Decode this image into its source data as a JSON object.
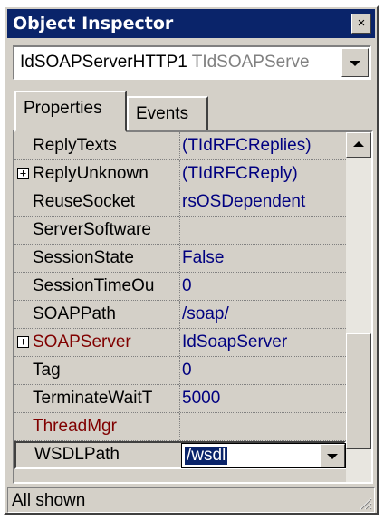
{
  "window": {
    "title": "Object Inspector",
    "close_glyph": "×"
  },
  "component": {
    "name": "IdSOAPServerHTTP1",
    "type": "TIdSOAPServe"
  },
  "tabs": [
    "Properties",
    "Events"
  ],
  "properties": [
    {
      "name": "ReplyTexts",
      "value": "(TIdRFCReplies)",
      "expandable": false,
      "highlight": false
    },
    {
      "name": "ReplyUnknown",
      "value": "(TIdRFCReply)",
      "expandable": true,
      "highlight": false
    },
    {
      "name": "ReuseSocket",
      "value": "rsOSDependent",
      "expandable": false,
      "highlight": false
    },
    {
      "name": "ServerSoftware",
      "value": "",
      "expandable": false,
      "highlight": false
    },
    {
      "name": "SessionState",
      "value": "False",
      "expandable": false,
      "highlight": false
    },
    {
      "name": "SessionTimeOu",
      "value": "0",
      "expandable": false,
      "highlight": false
    },
    {
      "name": "SOAPPath",
      "value": "/soap/",
      "expandable": false,
      "highlight": false
    },
    {
      "name": "SOAPServer",
      "value": "IdSoapServer",
      "expandable": true,
      "highlight": true
    },
    {
      "name": "Tag",
      "value": "0",
      "expandable": false,
      "highlight": false
    },
    {
      "name": "TerminateWaitT",
      "value": "5000",
      "expandable": false,
      "highlight": false
    },
    {
      "name": "ThreadMgr",
      "value": "",
      "expandable": false,
      "highlight": true
    }
  ],
  "selected": {
    "name": "WSDLPath",
    "value": "/wsdl"
  },
  "status": {
    "text": "All shown"
  },
  "colors": {
    "titlebar": "#0a246a",
    "value_text": "#000080",
    "event_property": "#800000",
    "face": "#d4d0c8"
  },
  "icons": {
    "close": "close-icon",
    "dropdown": "chevron-down-icon",
    "scroll_up": "chevron-up-icon",
    "expand": "plus-box-icon",
    "grip": "resize-grip-icon"
  }
}
